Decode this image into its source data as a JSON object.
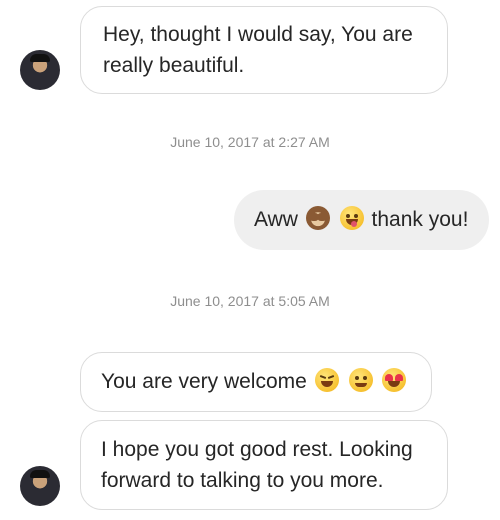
{
  "messages": [
    {
      "type": "incoming",
      "text": "Hey, thought I would say, You are really beautiful."
    },
    {
      "type": "timestamp",
      "text": "June 10, 2017 at 2:27 AM"
    },
    {
      "type": "outgoing",
      "text_before": "Aww",
      "emojis": [
        "see-no-evil-monkey",
        "face-savoring-food"
      ],
      "text_after": "thank you!"
    },
    {
      "type": "timestamp",
      "text": "June 10, 2017 at 5:05 AM"
    },
    {
      "type": "incoming",
      "text": "You are very welcome",
      "emojis": [
        "grinning-squinting-face",
        "smiling-face",
        "heart-eyes-face"
      ]
    },
    {
      "type": "incoming",
      "text": "I hope you got good rest. Looking forward to talking to you more."
    }
  ],
  "avatar_icon": "contact-avatar"
}
